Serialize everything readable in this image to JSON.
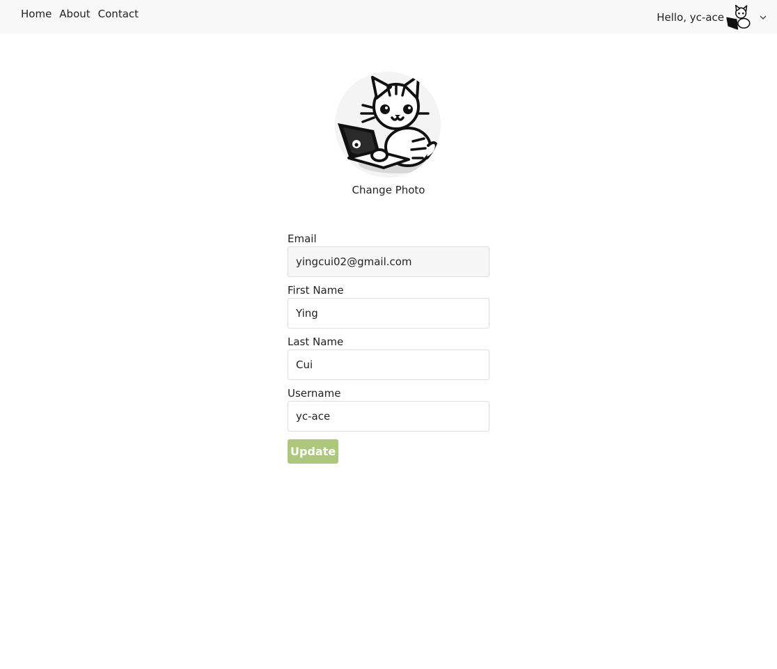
{
  "nav": {
    "links": [
      "Home",
      "About",
      "Contact"
    ],
    "greeting": "Hello, yc-ace",
    "avatar_icon": "cat-avatar-icon",
    "menu_icon": "chevron-down-icon"
  },
  "profile": {
    "photo_icon": "cat-with-laptop-icon",
    "change_photo_label": "Change Photo"
  },
  "form": {
    "email_label": "Email",
    "email_value": "yingcui02@gmail.com",
    "first_name_label": "First Name",
    "first_name_value": "Ying",
    "last_name_label": "Last Name",
    "last_name_value": "Cui",
    "username_label": "Username",
    "username_value": "yc-ace",
    "submit_label": "Update"
  },
  "colors": {
    "navbar_bg": "#f8f8f8",
    "button_bg": "#adc87c",
    "readonly_bg": "#f7f7f7"
  }
}
